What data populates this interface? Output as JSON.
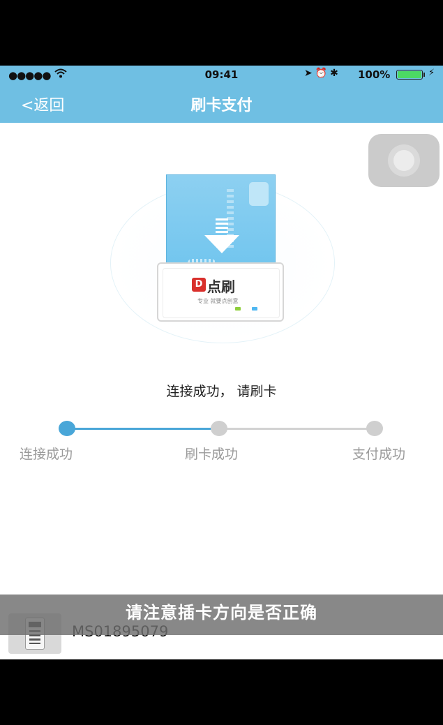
{
  "status_bar": {
    "signal": "●●●●●",
    "time": "09:41",
    "icons": "➤⏰✱",
    "battery": "100%",
    "battery_level": 1.0
  },
  "nav": {
    "back_label": "<返回",
    "title": "刷卡支付"
  },
  "reader_logo": {
    "brand": "点刷",
    "tagline": "专业 就要点创意"
  },
  "prompt": "连接成功，  请刷卡",
  "steps": [
    {
      "label": "连接成功",
      "state": "done"
    },
    {
      "label": "刷卡成功",
      "state": "pending"
    },
    {
      "label": "支付成功",
      "state": "pending"
    }
  ],
  "toast": "请注意插卡方向是否正确",
  "device": {
    "name": "MS01895079"
  },
  "colors": {
    "accent": "#6fbfe3",
    "step_active": "#49a6d8",
    "step_inactive": "#cfcfcf"
  }
}
